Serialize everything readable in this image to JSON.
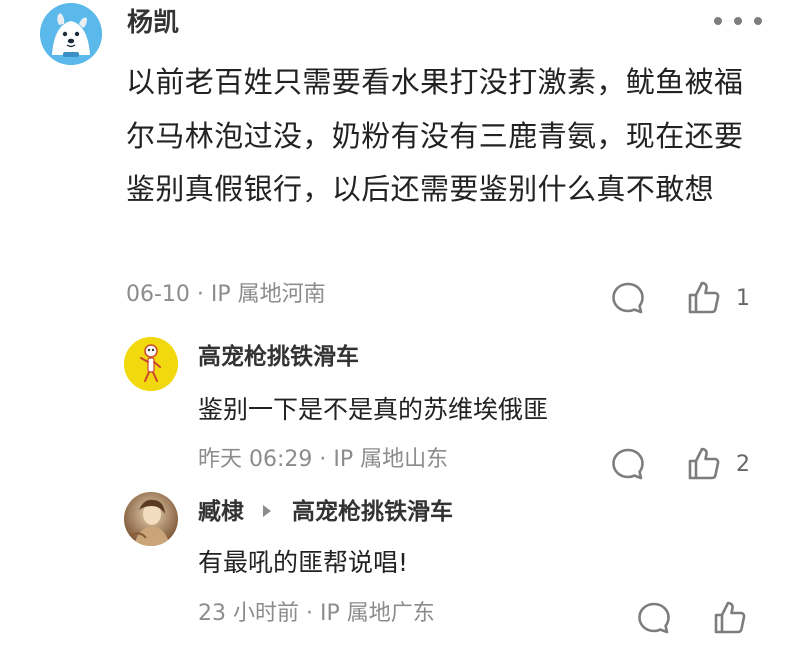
{
  "main_comment": {
    "avatar": "cartoon-dog-avatar",
    "username": "杨凯",
    "more_icon": "more-dots-icon",
    "text": "以前老百姓只需要看水果打没打激素，鱿鱼被福尔马林泡过没，奶粉有没有三鹿青氨，现在还要鉴别真假银行，以后还需要鉴别什么真不敢想",
    "meta": "06-10 · IP 属地河南",
    "like_count": "1"
  },
  "replies": [
    {
      "avatar": "skeleton-sticker-avatar",
      "username": "高宠枪挑铁滑车",
      "text": "鉴别一下是不是真的苏维埃俄匪",
      "meta": "昨天 06:29 · IP 属地山东",
      "like_count": "2"
    },
    {
      "avatar": "painting-portrait-avatar",
      "username": "臧棣",
      "reply_to": "高宠枪挑铁滑车",
      "text": "有最吼的匪帮说唱!",
      "meta": "23 小时前 · IP 属地广东",
      "like_count": ""
    }
  ],
  "colors": {
    "text_primary": "#222222",
    "username": "#333333",
    "meta": "#8c8c8c",
    "icon": "#7d7d7d"
  }
}
